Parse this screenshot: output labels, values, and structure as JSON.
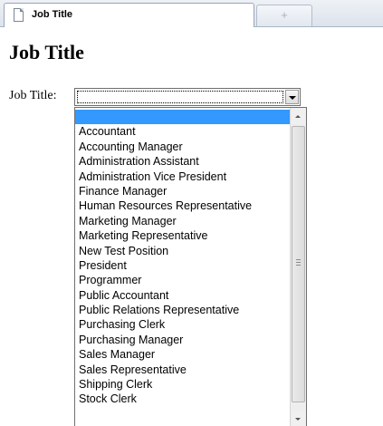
{
  "browser": {
    "tab_title": "Job Title",
    "new_tab_symbol": "+"
  },
  "page": {
    "heading": "Job Title",
    "field_label": "Job Title:"
  },
  "select": {
    "current_value": "",
    "options": [
      "",
      "Accountant",
      "Accounting Manager",
      "Administration Assistant",
      "Administration Vice President",
      "Finance Manager",
      "Human Resources Representative",
      "Marketing Manager",
      "Marketing Representative",
      "New Test Position",
      "President",
      "Programmer",
      "Public Accountant",
      "Public Relations Representative",
      "Purchasing Clerk",
      "Purchasing Manager",
      "Sales Manager",
      "Sales Representative",
      "Shipping Clerk",
      "Stock Clerk"
    ],
    "highlighted_index": 0
  },
  "colors": {
    "highlight": "#3399ff",
    "tabstrip": "#dde3ec"
  }
}
